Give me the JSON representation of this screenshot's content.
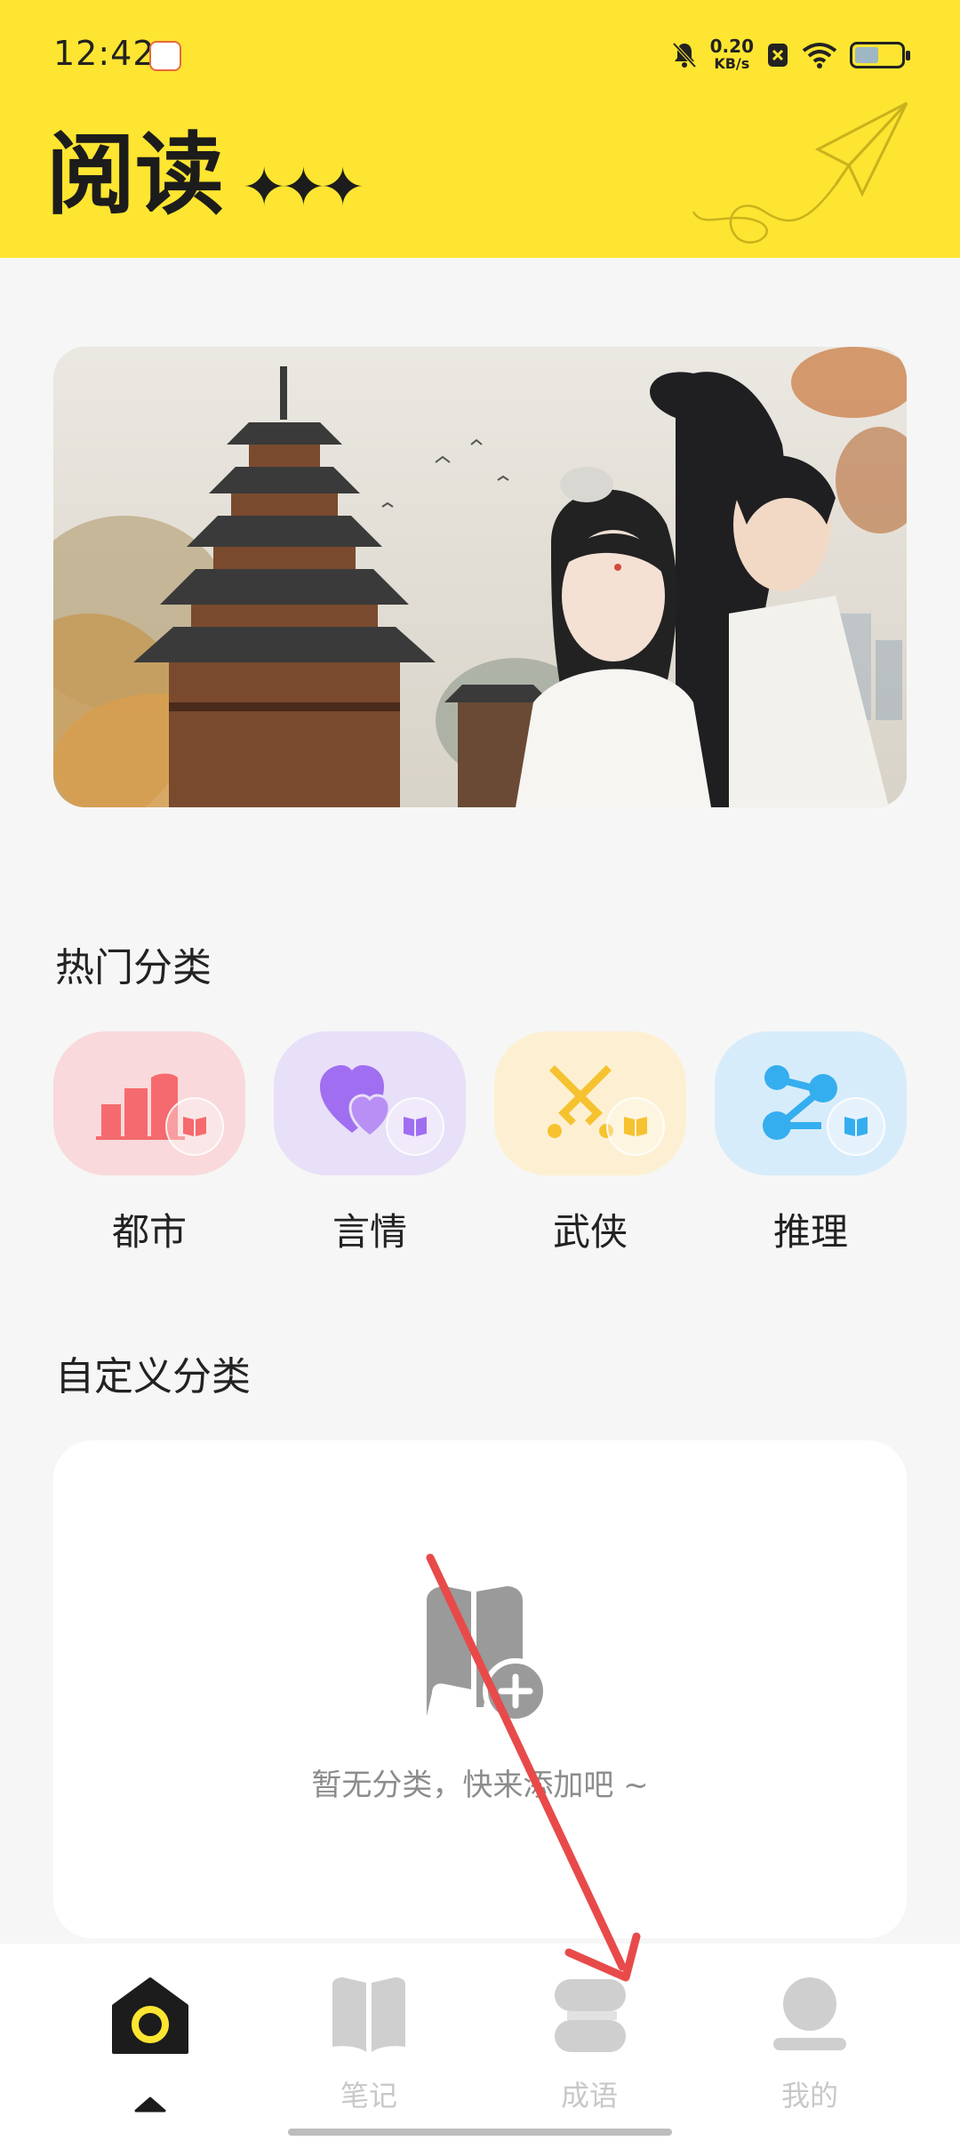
{
  "status_bar": {
    "time": "12:42",
    "net_speed_value": "0.20",
    "net_speed_unit": "KB/s"
  },
  "header": {
    "title": "阅读",
    "stars": "✦✦✦"
  },
  "hot_categories": {
    "title": "热门分类",
    "items": [
      {
        "label": "都市",
        "icon": "city-buildings-icon",
        "color": "#f9d9db",
        "accent": "#f56a6e"
      },
      {
        "label": "言情",
        "icon": "hearts-icon",
        "color": "#e8dff8",
        "accent": "#a06ef0"
      },
      {
        "label": "武侠",
        "icon": "crossed-swords-icon",
        "color": "#fdf0d2",
        "accent": "#f6c22f"
      },
      {
        "label": "推理",
        "icon": "network-nodes-icon",
        "color": "#d7ecfb",
        "accent": "#35aeef"
      }
    ]
  },
  "custom_categories": {
    "title": "自定义分类",
    "empty_text": "暂无分类，快来添加吧 ~"
  },
  "bottom_nav": {
    "items": [
      {
        "label": "",
        "icon": "home-icon",
        "active": true
      },
      {
        "label": "笔记",
        "icon": "open-book-icon",
        "active": false
      },
      {
        "label": "成语",
        "icon": "scroll-icon",
        "active": false
      },
      {
        "label": "我的",
        "icon": "profile-icon",
        "active": false
      }
    ]
  },
  "colors": {
    "header_bg": "#fde531",
    "annotation_arrow": "#e84a4a"
  }
}
